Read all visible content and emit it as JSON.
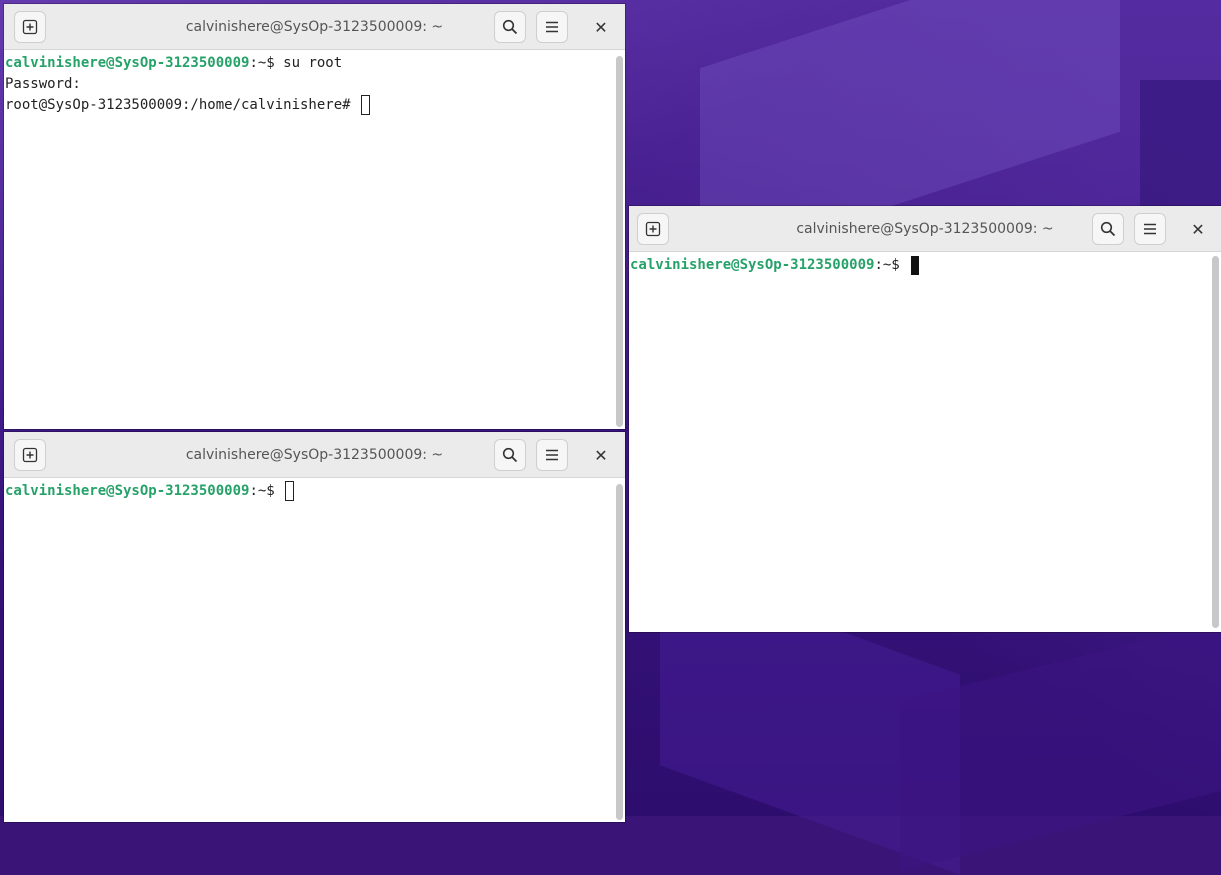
{
  "windows": {
    "top_left": {
      "title": "calvinishere@SysOp-3123500009: ~",
      "lines": [
        {
          "user": "calvinishere@SysOp-3123500009",
          "suffix": ":~$ su root"
        },
        {
          "text": "Password:"
        },
        {
          "text": "root@SysOp-3123500009:/home/calvinishere# "
        }
      ]
    },
    "bottom_left": {
      "title": "calvinishere@SysOp-3123500009: ~",
      "lines": [
        {
          "user": "calvinishere@SysOp-3123500009",
          "suffix": ":~$ "
        }
      ]
    },
    "right": {
      "title": "calvinishere@SysOp-3123500009: ~",
      "lines": [
        {
          "user": "calvinishere@SysOp-3123500009",
          "suffix": ":~$ "
        }
      ]
    }
  },
  "icons": {
    "new_tab": "new-tab-icon",
    "search": "search-icon",
    "menu": "hamburger-menu-icon",
    "close": "close-icon"
  },
  "close_glyph": "✕",
  "colors": {
    "prompt_user": "#26a269",
    "desktop_bg": "#3b1581",
    "titlebar": "#ebebeb"
  }
}
